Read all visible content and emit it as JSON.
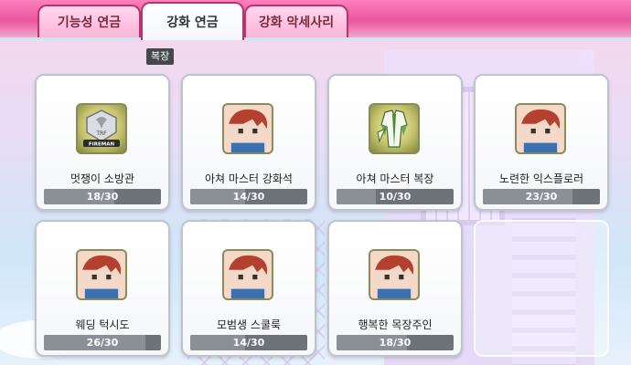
{
  "tabs": [
    {
      "label": "기능성 연금",
      "active": false
    },
    {
      "label": "강화 연금",
      "active": true
    },
    {
      "label": "강화 악세사리",
      "active": false
    }
  ],
  "tooltip": "복장",
  "items": [
    {
      "name": "멋쟁이 소방관",
      "progress": "18/30",
      "fraction": 0.6,
      "icon": "fireman-badge-icon"
    },
    {
      "name": "아쳐 마스터 강화석",
      "progress": "14/30",
      "fraction": 0.4667,
      "icon": "blue-gem-icon"
    },
    {
      "name": "아쳐 마스터 복장",
      "progress": "10/30",
      "fraction": 0.3333,
      "icon": "green-outfit-icon"
    },
    {
      "name": "노련한 익스플로러",
      "progress": "23/30",
      "fraction": 0.7667,
      "icon": "explorer-helmet-icon"
    },
    {
      "name": "웨딩 턱시도",
      "progress": "26/30",
      "fraction": 0.8667,
      "icon": "wedding-tuxedo-icon"
    },
    {
      "name": "모범생 스쿨룩",
      "progress": "14/30",
      "fraction": 0.4667,
      "icon": "school-look-icon"
    },
    {
      "name": "행복한 목장주인",
      "progress": "18/30",
      "fraction": 0.6,
      "icon": "ranch-hat-icon"
    }
  ],
  "colors": {
    "tab_bar": "#e8559c",
    "bar_bg": "#6e737a",
    "bar_fill": "#8b9097",
    "icon_bg": "#c8c46e"
  }
}
